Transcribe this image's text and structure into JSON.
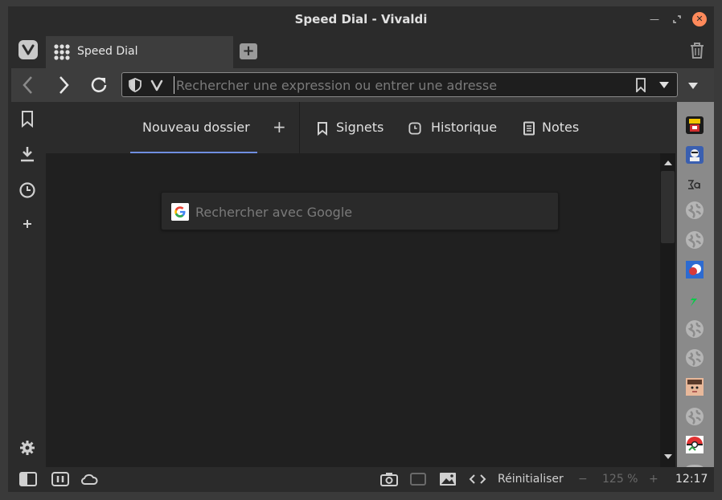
{
  "window": {
    "title": "Speed Dial - Vivaldi",
    "controls": [
      "minimize-icon",
      "maximize-icon",
      "close-icon"
    ],
    "close_color": "#ff8a5b"
  },
  "tabs": [
    {
      "label": "Speed Dial",
      "icon": "grid-icon",
      "active": true
    }
  ],
  "address_bar": {
    "placeholder": "Rechercher une expression ou entrer une adresse",
    "value": ""
  },
  "speed_dial_nav": {
    "folder_label": "Nouveau dossier",
    "add_label": "+",
    "bookmarks_label": "Signets",
    "history_label": "Historique",
    "notes_label": "Notes",
    "underline_color": "#6f8ee0"
  },
  "search": {
    "placeholder": "Rechercher avec Google",
    "engine_icon": "google-icon"
  },
  "left_panel": [
    "bookmarks-icon",
    "downloads-icon",
    "history-icon",
    "add-panel-icon",
    "settings-icon"
  ],
  "right_strip": [
    "favicon",
    "favicon",
    "favicon",
    "globe-icon",
    "globe-icon",
    "favicon",
    "favicon",
    "globe-icon",
    "globe-icon",
    "favicon",
    "globe-icon",
    "favicon",
    "globe-icon"
  ],
  "status": {
    "reset_label": "Réinitialiser",
    "minus_label": "−",
    "zoom_label": "125 %",
    "plus_label": "+",
    "clock": "12:17"
  },
  "colors": {
    "chrome": "#2b2b2b",
    "toolbar": "#3d3d3d",
    "content": "#202020"
  }
}
